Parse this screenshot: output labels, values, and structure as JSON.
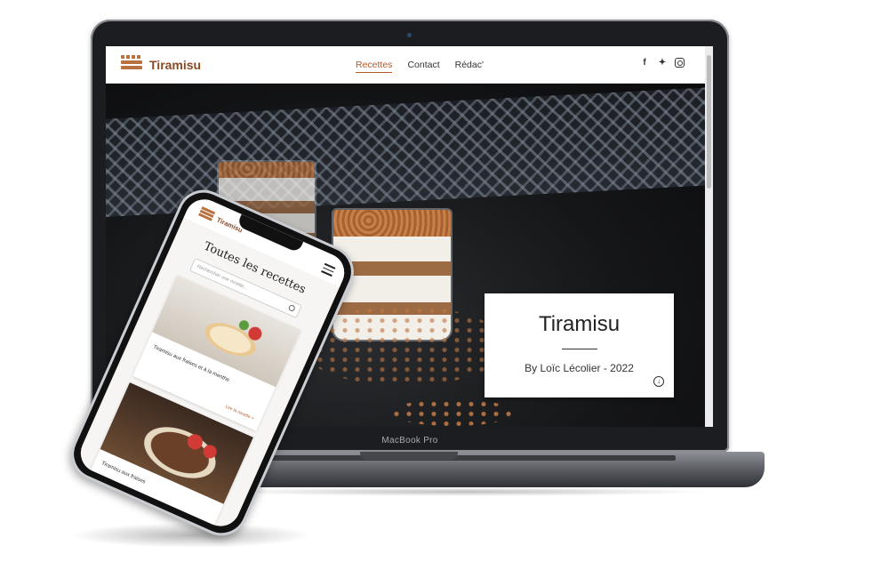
{
  "desktop": {
    "brand": "Tiramisu",
    "nav": [
      "Recettes",
      "Contact",
      "Rédac'"
    ],
    "active_nav": "Recettes",
    "social": [
      "facebook-icon",
      "twitter-icon",
      "instagram-icon"
    ],
    "hero": {
      "title": "Tiramisu",
      "subtitle": "By Loïc Lécolier - 2022"
    }
  },
  "laptop_label": "MacBook Pro",
  "mobile": {
    "brand": "Tiramisu",
    "page_title": "Toutes les recettes",
    "search_placeholder": "Rechercher une recette...",
    "cards": [
      {
        "caption": "Tiramisu aux fraises et à la menthe",
        "link": "Lire la recette  >"
      },
      {
        "caption": "Tiramisu aux fraises"
      }
    ]
  },
  "colors": {
    "accent": "#b05a2a",
    "brand": "#8a4a22"
  }
}
